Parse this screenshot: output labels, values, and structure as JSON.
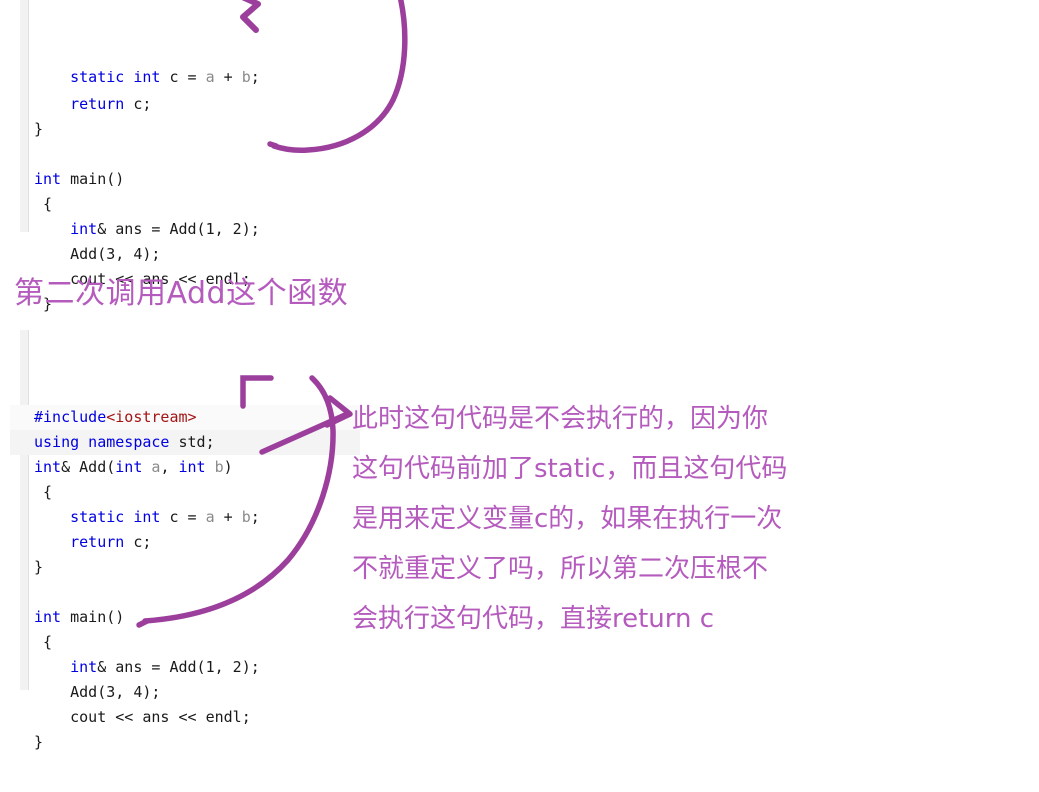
{
  "colors": {
    "ink_purple": "#9c3f9c",
    "heading_purple": "#b45bbd",
    "keyword_blue": "#0000e0",
    "header_red": "#a31515",
    "param_gray": "#8a8a8a",
    "code_text": "#1a1a1a",
    "gutter_gray": "#f2f2f2",
    "page_background": "#ffffff"
  },
  "code_block_top": {
    "title": "first-call-code-snippet",
    "lines": [
      {
        "id": "top-l1",
        "clipped": true,
        "tokens": [
          {
            "t": "    ",
            "c": "pln"
          },
          {
            "t": "static int",
            "c": "kw"
          },
          {
            "t": " c = ",
            "c": "pln"
          },
          {
            "t": "a",
            "c": "prm"
          },
          {
            "t": " + ",
            "c": "pln"
          },
          {
            "t": "b",
            "c": "prm"
          },
          {
            "t": ";",
            "c": "pln"
          }
        ]
      },
      {
        "id": "top-l2",
        "tokens": [
          {
            "t": "    ",
            "c": "pln"
          },
          {
            "t": "return",
            "c": "kw"
          },
          {
            "t": " c;",
            "c": "pln"
          }
        ]
      },
      {
        "id": "top-l3",
        "tokens": [
          {
            "t": "}",
            "c": "pln"
          }
        ]
      },
      {
        "id": "top-l4",
        "tokens": [
          {
            "t": "",
            "c": "pln"
          }
        ]
      },
      {
        "id": "top-l5",
        "tokens": [
          {
            "t": "int",
            "c": "kw"
          },
          {
            "t": " main()",
            "c": "pln"
          }
        ]
      },
      {
        "id": "top-l6",
        "tokens": [
          {
            "t": " {",
            "c": "pln"
          }
        ]
      },
      {
        "id": "top-l7",
        "tokens": [
          {
            "t": "    ",
            "c": "pln"
          },
          {
            "t": "int",
            "c": "kw"
          },
          {
            "t": "& ans = Add(1, 2);",
            "c": "pln"
          }
        ]
      },
      {
        "id": "top-l8",
        "tokens": [
          {
            "t": "    Add(3, 4);",
            "c": "pln"
          }
        ]
      },
      {
        "id": "top-l9",
        "tokens": [
          {
            "t": "    cout << ans << endl;",
            "c": "pln"
          }
        ]
      },
      {
        "id": "top-l10",
        "tokens": [
          {
            "t": " }",
            "c": "pln"
          }
        ]
      }
    ]
  },
  "section_heading": {
    "text": "第二次调用Add这个函数"
  },
  "code_block_bottom": {
    "title": "second-call-code-snippet",
    "lines": [
      {
        "id": "bot-l1",
        "stripe": "stripe-soft",
        "tokens": [
          {
            "t": "#include",
            "c": "pre"
          },
          {
            "t": "<iostream>",
            "c": "hdr"
          }
        ]
      },
      {
        "id": "bot-l2",
        "stripe": "stripe",
        "tokens": [
          {
            "t": "using namespace",
            "c": "kw"
          },
          {
            "t": " std;",
            "c": "pln"
          }
        ]
      },
      {
        "id": "bot-l3",
        "stripe": "none",
        "tokens": [
          {
            "t": "int",
            "c": "kw"
          },
          {
            "t": "& Add(",
            "c": "pln"
          },
          {
            "t": "int",
            "c": "kw"
          },
          {
            "t": " ",
            "c": "pln"
          },
          {
            "t": "a",
            "c": "prm"
          },
          {
            "t": ", ",
            "c": "pln"
          },
          {
            "t": "int",
            "c": "kw"
          },
          {
            "t": " ",
            "c": "pln"
          },
          {
            "t": "b",
            "c": "prm"
          },
          {
            "t": ")",
            "c": "pln"
          }
        ]
      },
      {
        "id": "bot-l4",
        "stripe": "none",
        "tokens": [
          {
            "t": " {",
            "c": "pln"
          }
        ]
      },
      {
        "id": "bot-l5",
        "stripe": "none",
        "tokens": [
          {
            "t": "    ",
            "c": "pln"
          },
          {
            "t": "static int",
            "c": "kw"
          },
          {
            "t": " c = ",
            "c": "pln"
          },
          {
            "t": "a",
            "c": "prm"
          },
          {
            "t": " + ",
            "c": "pln"
          },
          {
            "t": "b",
            "c": "prm"
          },
          {
            "t": ";",
            "c": "pln"
          }
        ]
      },
      {
        "id": "bot-l6",
        "stripe": "none",
        "tokens": [
          {
            "t": "    ",
            "c": "pln"
          },
          {
            "t": "return",
            "c": "kw"
          },
          {
            "t": " c;",
            "c": "pln"
          }
        ]
      },
      {
        "id": "bot-l7",
        "stripe": "none",
        "tokens": [
          {
            "t": "}",
            "c": "pln"
          }
        ]
      },
      {
        "id": "bot-l8",
        "stripe": "none",
        "tokens": [
          {
            "t": "",
            "c": "pln"
          }
        ]
      },
      {
        "id": "bot-l9",
        "stripe": "none",
        "tokens": [
          {
            "t": "int",
            "c": "kw"
          },
          {
            "t": " main()",
            "c": "pln"
          }
        ]
      },
      {
        "id": "bot-l10",
        "stripe": "none",
        "tokens": [
          {
            "t": " {",
            "c": "pln"
          }
        ]
      },
      {
        "id": "bot-l11",
        "stripe": "none",
        "tokens": [
          {
            "t": "    ",
            "c": "pln"
          },
          {
            "t": "int",
            "c": "kw"
          },
          {
            "t": "& ans = Add(1, 2);",
            "c": "pln"
          }
        ]
      },
      {
        "id": "bot-l12",
        "stripe": "none",
        "tokens": [
          {
            "t": "    Add(3, 4);",
            "c": "pln"
          }
        ]
      },
      {
        "id": "bot-l13",
        "stripe": "none",
        "tokens": [
          {
            "t": "    cout << ans << endl;",
            "c": "pln"
          }
        ]
      },
      {
        "id": "bot-l14",
        "stripe": "none",
        "tokens": [
          {
            "t": "}",
            "c": "pln"
          }
        ]
      }
    ]
  },
  "annotation": {
    "lines": [
      "此时这句代码是不会执行的，因为你",
      "这句代码前加了static，而且这句代码",
      "是用来定义变量c的，如果在执行一次",
      "不就重定义了吗，所以第二次压根不",
      "会执行这句代码，直接return c"
    ]
  },
  "ink_marks": {
    "top_loop_note": "curve from top-right looping down to Add(1, 2);",
    "top_zigzag_note": "small hand-drawn 3-like zigzag above code",
    "bottom_arrow_note": "arrow from static int c = a + b; pointing right to annotation",
    "bottom_bracket_note": "bracket near int& Add(int a, int b) signature",
    "bottom_curve_note": "long curve from Add(3, 4); sweeping up to the function signature"
  }
}
